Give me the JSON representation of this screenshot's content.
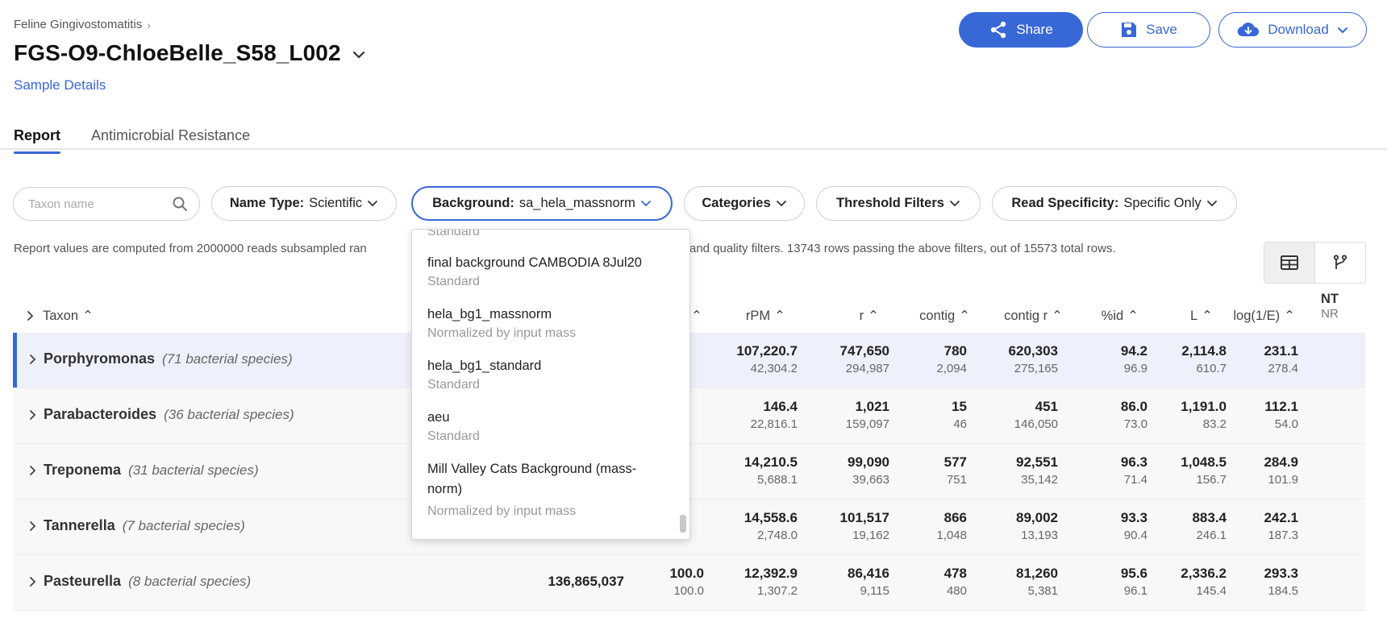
{
  "breadcrumb": {
    "project": "Feline Gingivostomatitis"
  },
  "sample": {
    "title": "FGS-O9-ChloeBelle_S58_L002",
    "details_link": "Sample Details"
  },
  "actions": {
    "share": "Share",
    "save": "Save",
    "download": "Download"
  },
  "tabs": [
    {
      "label": "Report",
      "active": true
    },
    {
      "label": "Antimicrobial Resistance",
      "active": false
    }
  ],
  "filters": {
    "search_placeholder": "Taxon name",
    "name_type_label": "Name Type:",
    "name_type_value": "Scientific",
    "background_label": "Background:",
    "background_value": "sa_hela_massnorm",
    "categories": "Categories",
    "threshold": "Threshold Filters",
    "read_specificity_label": "Read Specificity:",
    "read_specificity_value": "Specific Only"
  },
  "info": {
    "left": "Report values are computed from 2000000 reads subsampled ran",
    "right": "and quality filters. 13743 rows passing the above filters, out of 15573 total rows."
  },
  "columns": {
    "taxon": "Taxon",
    "rpm": "rPM",
    "r": "r",
    "contig": "contig",
    "contig_r": "contig r",
    "pct_id": "%id",
    "L": "L",
    "log": "log(1/E)",
    "nt": "NT",
    "nr": "NR"
  },
  "background_dropdown": {
    "partial_top": "Standard",
    "items": [
      {
        "name": "final background CAMBODIA 8Jul20",
        "desc": "Standard"
      },
      {
        "name": "hela_bg1_massnorm",
        "desc": "Normalized by input mass"
      },
      {
        "name": "hela_bg1_standard",
        "desc": "Standard"
      },
      {
        "name": "aeu",
        "desc": "Standard"
      },
      {
        "name": "Mill Valley Cats Background (mass-norm)",
        "desc": "Normalized by input mass"
      }
    ]
  },
  "rows": [
    {
      "genus": "Porphyromonas",
      "count": "(71 bacterial species)",
      "score": "",
      "zpct": [
        "",
        ""
      ],
      "rpm": [
        "107,220.7",
        "42,304.2"
      ],
      "r": [
        "747,650",
        "294,987"
      ],
      "contig": [
        "780",
        "2,094"
      ],
      "contig_r": [
        "620,303",
        "275,165"
      ],
      "pid": [
        "94.2",
        "96.9"
      ],
      "L": [
        "2,114.8",
        "610.7"
      ],
      "log": [
        "231.1",
        "278.4"
      ]
    },
    {
      "genus": "Parabacteroides",
      "count": "(36 bacterial species)",
      "score": "",
      "zpct": [
        "",
        ""
      ],
      "rpm": [
        "146.4",
        "22,816.1"
      ],
      "r": [
        "1,021",
        "159,097"
      ],
      "contig": [
        "15",
        "46"
      ],
      "contig_r": [
        "451",
        "146,050"
      ],
      "pid": [
        "86.0",
        "73.0"
      ],
      "L": [
        "1,191.0",
        "83.2"
      ],
      "log": [
        "112.1",
        "54.0"
      ]
    },
    {
      "genus": "Treponema",
      "count": "(31 bacterial species)",
      "score": "",
      "zpct": [
        "",
        ""
      ],
      "rpm": [
        "14,210.5",
        "5,688.1"
      ],
      "r": [
        "99,090",
        "39,663"
      ],
      "contig": [
        "577",
        "751"
      ],
      "contig_r": [
        "92,551",
        "35,142"
      ],
      "pid": [
        "96.3",
        "71.4"
      ],
      "L": [
        "1,048.5",
        "156.7"
      ],
      "log": [
        "284.9",
        "101.9"
      ]
    },
    {
      "genus": "Tannerella",
      "count": "(7 bacterial species)",
      "score": "",
      "zpct": [
        "",
        ""
      ],
      "rpm": [
        "14,558.6",
        "2,748.0"
      ],
      "r": [
        "101,517",
        "19,162"
      ],
      "contig": [
        "866",
        "1,048"
      ],
      "contig_r": [
        "89,002",
        "13,193"
      ],
      "pid": [
        "93.3",
        "90.4"
      ],
      "L": [
        "883.4",
        "246.1"
      ],
      "log": [
        "242.1",
        "187.3"
      ]
    },
    {
      "genus": "Pasteurella",
      "count": "(8 bacterial species)",
      "score": "136,865,037",
      "zpct": [
        "100.0",
        "100.0"
      ],
      "rpm": [
        "12,392.9",
        "1,307.2"
      ],
      "r": [
        "86,416",
        "9,115"
      ],
      "contig": [
        "478",
        "480"
      ],
      "contig_r": [
        "81,260",
        "5,381"
      ],
      "pid": [
        "95.6",
        "96.1"
      ],
      "L": [
        "2,336.2",
        "145.4"
      ],
      "log": [
        "293.3",
        "184.5"
      ]
    }
  ]
}
